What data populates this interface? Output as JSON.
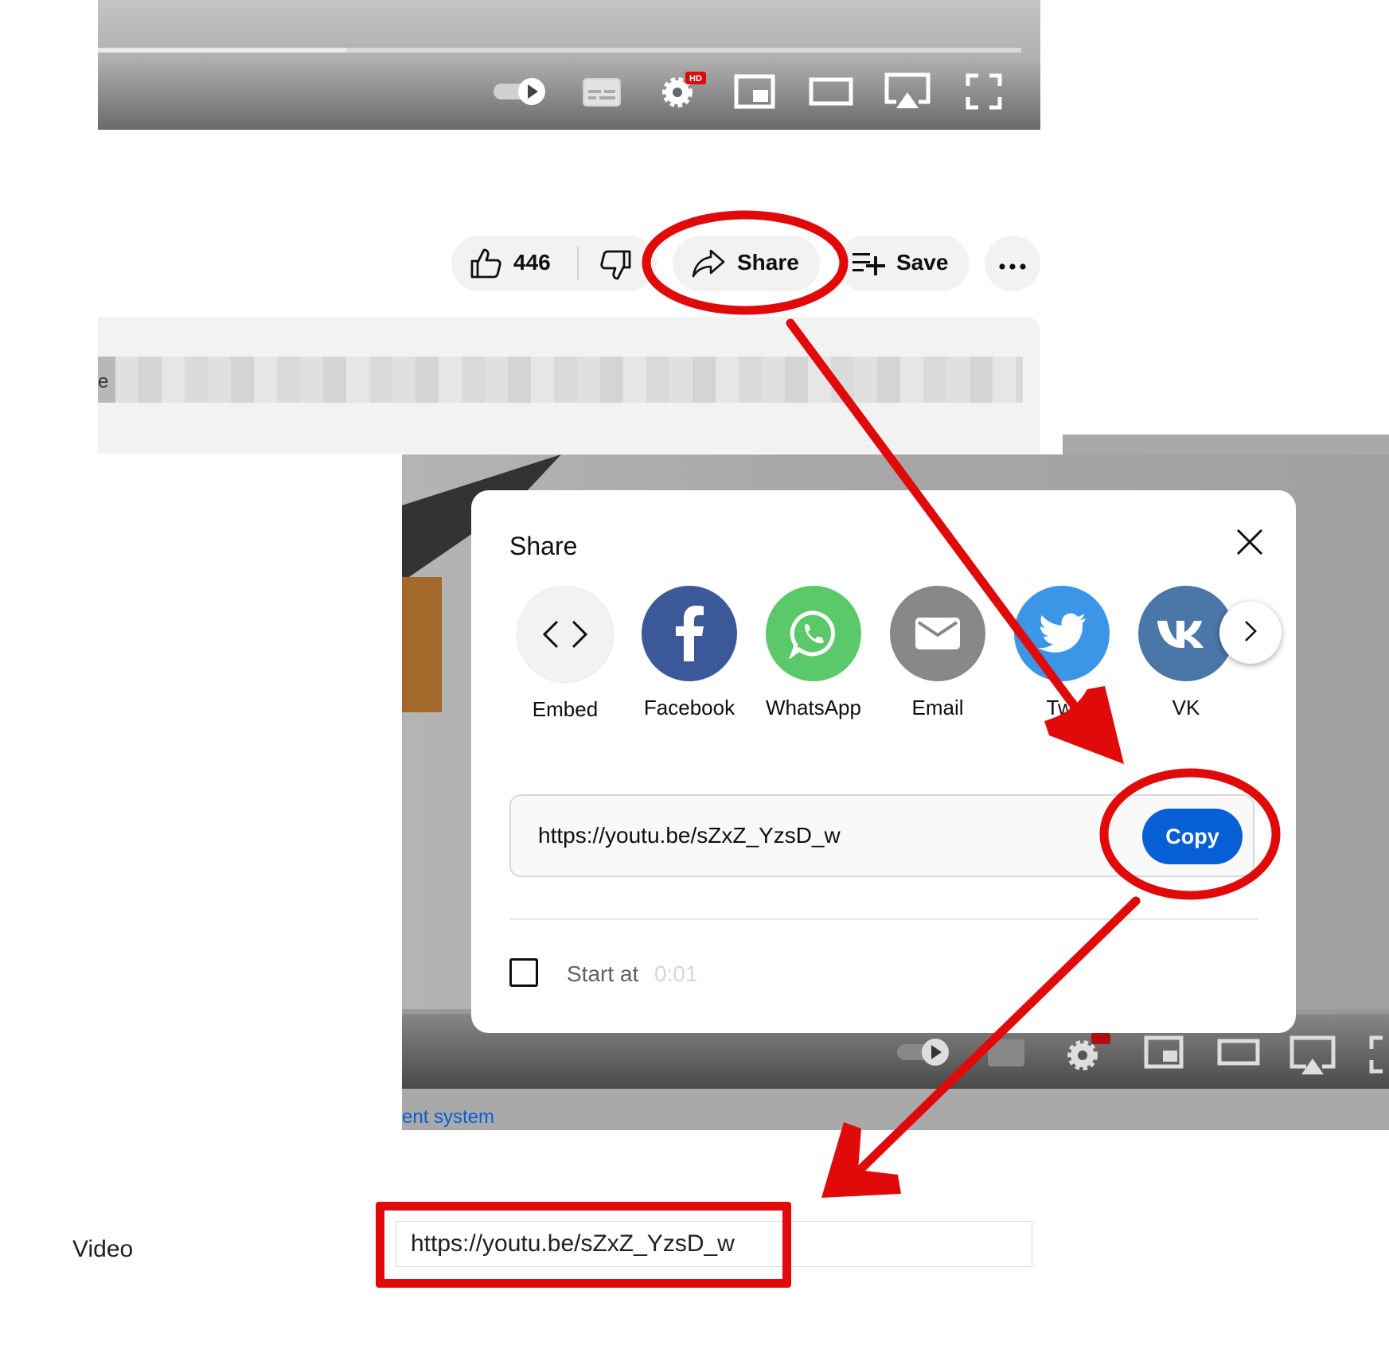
{
  "player": {
    "progress": 0.27,
    "controls": [
      "autoplay-toggle-icon",
      "subtitles-icon",
      "settings-icon",
      "miniplayer-icon",
      "theater-mode-icon",
      "airplay-icon",
      "fullscreen-icon"
    ],
    "hd_badge": "HD"
  },
  "actions": {
    "like_count": "446",
    "share_label": "Share",
    "save_label": "Save"
  },
  "description": {
    "fragment": "e"
  },
  "share_modal": {
    "title": "Share",
    "options": [
      {
        "label": "Embed",
        "icon": "embed-icon",
        "color": "#f2f2f2"
      },
      {
        "label": "Facebook",
        "icon": "facebook-icon",
        "color": "#3b5998"
      },
      {
        "label": "WhatsApp",
        "icon": "whatsapp-icon",
        "color": "#5bc96a"
      },
      {
        "label": "Email",
        "icon": "email-icon",
        "color": "#888888"
      },
      {
        "label": "Twi",
        "icon": "twitter-icon",
        "color": "#3b96e8"
      },
      {
        "label": "VK",
        "icon": "vk-icon",
        "color": "#4a76a8"
      }
    ],
    "url": "https://youtu.be/sZxZ_YzsD_w",
    "copy_label": "Copy",
    "start_at_label": "Start at",
    "start_at_time": "0:01"
  },
  "background": {
    "link_fragment": "ent system"
  },
  "form": {
    "video_label": "Video",
    "video_value": "https://youtu.be/sZxZ_YzsD_w"
  },
  "annotation_color": "#e00a0a",
  "accent_color": "#065fd4"
}
